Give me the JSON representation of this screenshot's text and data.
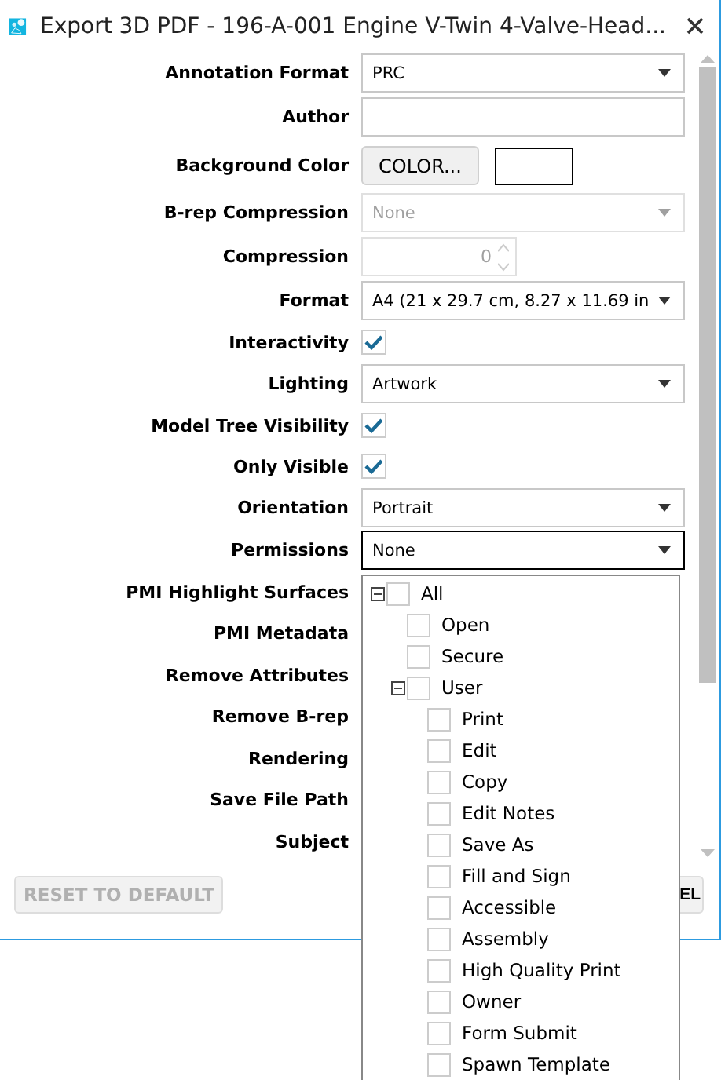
{
  "window": {
    "title": "Export 3D PDF - 196-A-001 Engine V-Twin 4-Valve-Head..."
  },
  "fields": [
    {
      "label": "Annotation Format",
      "kind": "combo",
      "value": "PRC",
      "disabled": false,
      "focused": false
    },
    {
      "label": "Author",
      "kind": "text"
    },
    {
      "label": "Background Color",
      "kind": "color",
      "button": "COLOR...",
      "color": "#ffffff"
    },
    {
      "label": "B-rep Compression",
      "kind": "combo",
      "value": "None",
      "disabled": true,
      "focused": false
    },
    {
      "label": "Compression",
      "kind": "spin",
      "value": "0",
      "disabled": true
    },
    {
      "label": "Format",
      "kind": "combo",
      "value": "A4 (21 x 29.7 cm, 8.27 x 11.69 in",
      "disabled": false,
      "focused": false
    },
    {
      "label": "Interactivity",
      "kind": "check",
      "checked": true
    },
    {
      "label": "Lighting",
      "kind": "combo",
      "value": "Artwork",
      "disabled": false,
      "focused": false
    },
    {
      "label": "Model Tree Visibility",
      "kind": "check",
      "checked": true
    },
    {
      "label": "Only Visible",
      "kind": "check",
      "checked": true
    },
    {
      "label": "Orientation",
      "kind": "combo",
      "value": "Portrait",
      "disabled": false,
      "focused": false
    },
    {
      "label": "Permissions",
      "kind": "combo",
      "value": "None",
      "disabled": false,
      "focused": true
    },
    {
      "label": "PMI Highlight Surfaces",
      "kind": "covered"
    },
    {
      "label": "PMI Metadata",
      "kind": "covered"
    },
    {
      "label": "Remove Attributes",
      "kind": "covered"
    },
    {
      "label": "Remove B-rep",
      "kind": "covered"
    },
    {
      "label": "Rendering",
      "kind": "covered"
    },
    {
      "label": "Save File Path",
      "kind": "covered"
    },
    {
      "label": "Subject",
      "kind": "covered"
    }
  ],
  "footer": {
    "reset": {
      "label": "RESET TO DEFAULT",
      "disabled": true
    },
    "cancel": {
      "label": "EL"
    }
  },
  "permissions_dropdown": {
    "items": [
      {
        "label": "All",
        "checked": false,
        "expanded": true,
        "children": [
          {
            "label": "Open",
            "checked": false
          },
          {
            "label": "Secure",
            "checked": false
          },
          {
            "label": "User",
            "checked": false,
            "expanded": true,
            "children": [
              {
                "label": "Print",
                "checked": false
              },
              {
                "label": "Edit",
                "checked": false
              },
              {
                "label": "Copy",
                "checked": false
              },
              {
                "label": "Edit Notes",
                "checked": false
              },
              {
                "label": "Save As",
                "checked": false
              },
              {
                "label": "Fill and Sign",
                "checked": false
              },
              {
                "label": "Accessible",
                "checked": false
              },
              {
                "label": "Assembly",
                "checked": false
              },
              {
                "label": "High Quality Print",
                "checked": false
              },
              {
                "label": "Owner",
                "checked": false
              },
              {
                "label": "Form Submit",
                "checked": false
              },
              {
                "label": "Spawn Template",
                "checked": false
              }
            ]
          }
        ]
      }
    ]
  }
}
